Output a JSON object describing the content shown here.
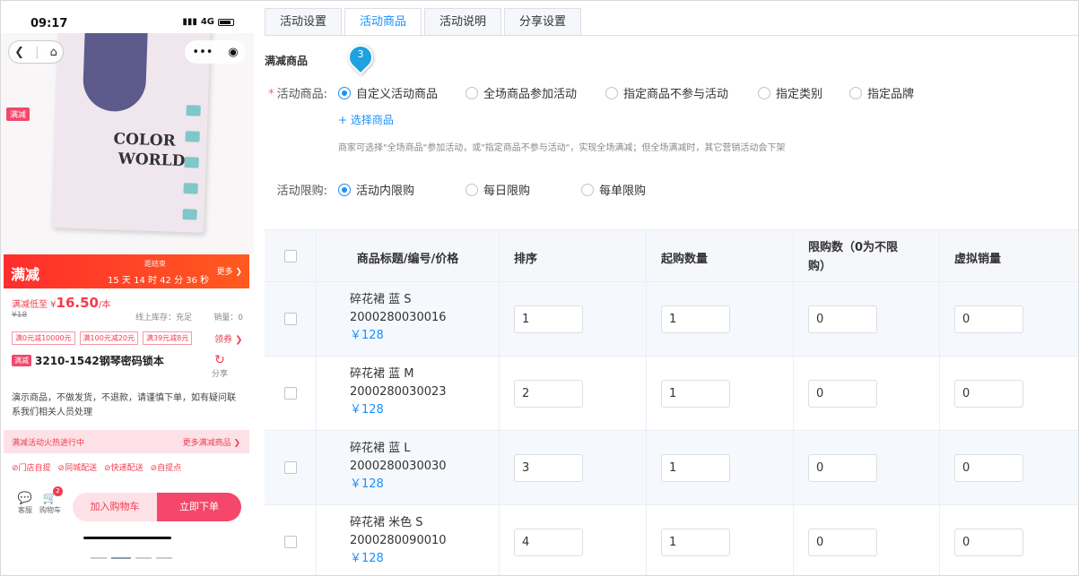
{
  "phone": {
    "status_time": "09:17",
    "network": "4G",
    "promo_tag": "满减",
    "notebook_text_line1": "COLOR",
    "notebook_text_line2": "WORLD",
    "flash": {
      "title": "满减",
      "countdown_label": "距结束",
      "countdown": "15 天 14 时 42 分 36 秒",
      "more": "更多 ❯"
    },
    "price_prefix": "满减低至 ¥",
    "price_value": "16.50",
    "price_unit": "/本",
    "original_price": "¥18",
    "stock": "线上库存：充足",
    "sales": "销量：0",
    "coupons": [
      "满0元减10000元",
      "满100元减20元",
      "满39元减8元"
    ],
    "coupon_link": "领券 ❯",
    "product_tag": "满减",
    "product_title": "3210-1542钢琴密码锁本",
    "share_label": "分享",
    "description": "演示商品，不做发货，不退款，请谨慎下单，如有疑问联系我们相关人员处理",
    "activity_left": "满减活动火热进行中",
    "activity_right": "更多满减商品 ❯",
    "delivery": [
      "⊘门店自提",
      "⊘同城配送",
      "⊘快递配送",
      "⊘自提点"
    ],
    "nav_service": "客服",
    "nav_cart": "购物车",
    "cart_badge": "2",
    "btn_add_cart": "加入购物车",
    "btn_buy": "立即下单"
  },
  "tabs": [
    "活动设置",
    "活动商品",
    "活动说明",
    "分享设置"
  ],
  "active_tab": "活动商品",
  "section_title": "满减商品",
  "step_number": "3",
  "goods_label": "活动商品:",
  "goods_options": [
    "自定义活动商品",
    "全场商品参加活动",
    "指定商品不参与活动",
    "指定类别",
    "指定品牌"
  ],
  "goods_selected": "自定义活动商品",
  "select_goods": "+ 选择商品",
  "hint": "商家可选择\"全场商品\"参加活动，或\"指定商品不参与活动\"，实现全场满减；但全场满减时，其它营销活动会下架",
  "limit_label": "活动限购:",
  "limit_options": [
    "活动内限购",
    "每日限购",
    "每单限购"
  ],
  "limit_selected": "活动内限购",
  "table": {
    "headers": [
      "商品标题/编号/价格",
      "排序",
      "起购数量",
      "限购数（0为不限购）",
      "虚拟销量"
    ],
    "rows": [
      {
        "title": "碎花裙 蓝 S",
        "code": "2000280030016",
        "price": "￥128",
        "sort": "1",
        "min_qty": "1",
        "limit": "0",
        "virtual_sales": "0"
      },
      {
        "title": "碎花裙 蓝 M",
        "code": "2000280030023",
        "price": "￥128",
        "sort": "2",
        "min_qty": "1",
        "limit": "0",
        "virtual_sales": "0"
      },
      {
        "title": "碎花裙 蓝 L",
        "code": "2000280030030",
        "price": "￥128",
        "sort": "3",
        "min_qty": "1",
        "limit": "0",
        "virtual_sales": "0"
      },
      {
        "title": "碎花裙 米色 S",
        "code": "2000280090010",
        "price": "￥128",
        "sort": "4",
        "min_qty": "1",
        "limit": "0",
        "virtual_sales": "0"
      }
    ]
  },
  "colors": {
    "primary": "#1890ff",
    "promo_red": "#f23c4e",
    "marker": "#1ea2e0"
  }
}
